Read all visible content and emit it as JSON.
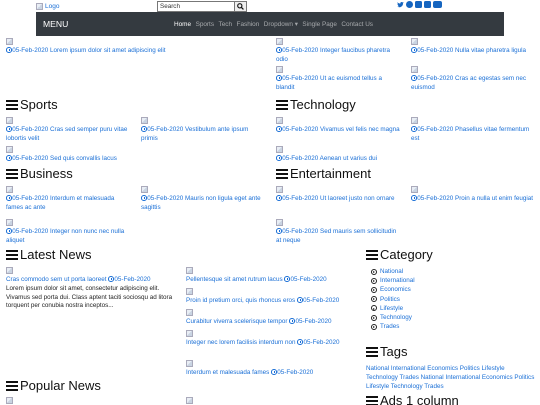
{
  "header": {
    "logo_alt": "Logo",
    "search_value": "Search",
    "social_icons": [
      "twitter-icon",
      "facebook-icon",
      "linkedin-icon",
      "instagram-icon",
      "youtube-icon"
    ]
  },
  "nav": {
    "menu_label": "MENU",
    "items": [
      "Home",
      "Sports",
      "Tech",
      "Fashion",
      "Dropdown ▾",
      "Single Page",
      "Contact Us"
    ]
  },
  "top": {
    "left_post": {
      "date": "05-Feb-2020",
      "title": "Lorem ipsum dolor sit amet adipiscing elit"
    },
    "right_posts": [
      {
        "date": "05-Feb-2020",
        "title": "Integer faucibus pharetra odio"
      },
      {
        "date": "05-Feb-2020",
        "title": "Nulla vitae pharetra ligula"
      },
      {
        "date": "05-Feb-2020",
        "title": "Ut ac euismod tellus a blandit"
      },
      {
        "date": "05-Feb-2020",
        "title": "Cras ac egestas sem nec euismod"
      }
    ]
  },
  "sports": {
    "heading": "Sports",
    "posts": [
      {
        "date": "05-Feb-2020",
        "title": "Cras sed semper puru vitae lobortis velit"
      },
      {
        "date": "05-Feb-2020",
        "title": "Vestibulum ante ipsum primis"
      },
      {
        "date": "05-Feb-2020",
        "title": "Sed quis convallis lacus"
      }
    ]
  },
  "technology": {
    "heading": "Technology",
    "posts": [
      {
        "date": "05-Feb-2020",
        "title": "Vivamus vel felis nec magna"
      },
      {
        "date": "05-Feb-2020",
        "title": "Phasellus vitae fermentum est"
      },
      {
        "date": "05-Feb-2020",
        "title": "Aenean ut varius dui"
      }
    ]
  },
  "business": {
    "heading": "Business",
    "posts": [
      {
        "date": "05-Feb-2020",
        "title": "Interdum et malesuada fames ac ante"
      },
      {
        "date": "05-Feb-2020",
        "title": "Mauris non ligula eget ante sagittis"
      },
      {
        "date": "05-Feb-2020",
        "title": "Integer non nunc nec nulla aliquet"
      }
    ]
  },
  "entertainment": {
    "heading": "Entertainment",
    "posts": [
      {
        "date": "05-Feb-2020",
        "title": "Ut laoreet justo non ornare"
      },
      {
        "date": "05-Feb-2020",
        "title": "Proin a nulla ut enim feugiat"
      },
      {
        "date": "05-Feb-2020",
        "title": "Sed mauris sem sollicitudin at neque"
      }
    ]
  },
  "latest": {
    "heading": "Latest News",
    "main": {
      "title": "Cras commodo sem ut porta laoreet",
      "date": "05-Feb-2020",
      "excerpt": "Lorem ipsum dolor sit amet, consectetur adipiscing elit. Vivamus sed porta dui. Class aptent taciti sociosqu ad litora torquent per conubia nostra inceptos..."
    },
    "list": [
      {
        "title": "Pellentesque sit amet rutrum lacus",
        "date": "05-Feb-2020"
      },
      {
        "title": "Proin id pretium orci, quis rhoncus eros",
        "date": "05-Feb-2020"
      },
      {
        "title": "Curabitur viverra scelerisque tempor",
        "date": "05-Feb-2020"
      },
      {
        "title": "Integer nec lorem facilisis interdum non",
        "date": "05-Feb-2020"
      },
      {
        "title": "Interdum et malesuada fames",
        "date": "05-Feb-2020"
      }
    ]
  },
  "popular": {
    "heading": "Popular News"
  },
  "category": {
    "heading": "Category",
    "items": [
      "National",
      "International",
      "Economics",
      "Politics",
      "Lifestyle",
      "Technology",
      "Trades"
    ]
  },
  "tags": {
    "heading": "Tags",
    "text": "National International Economics Politics Lifestyle Technology Trades National International Economics Politics Lifestyle Technology Trades"
  },
  "ads": {
    "heading": "Ads 1 column"
  }
}
